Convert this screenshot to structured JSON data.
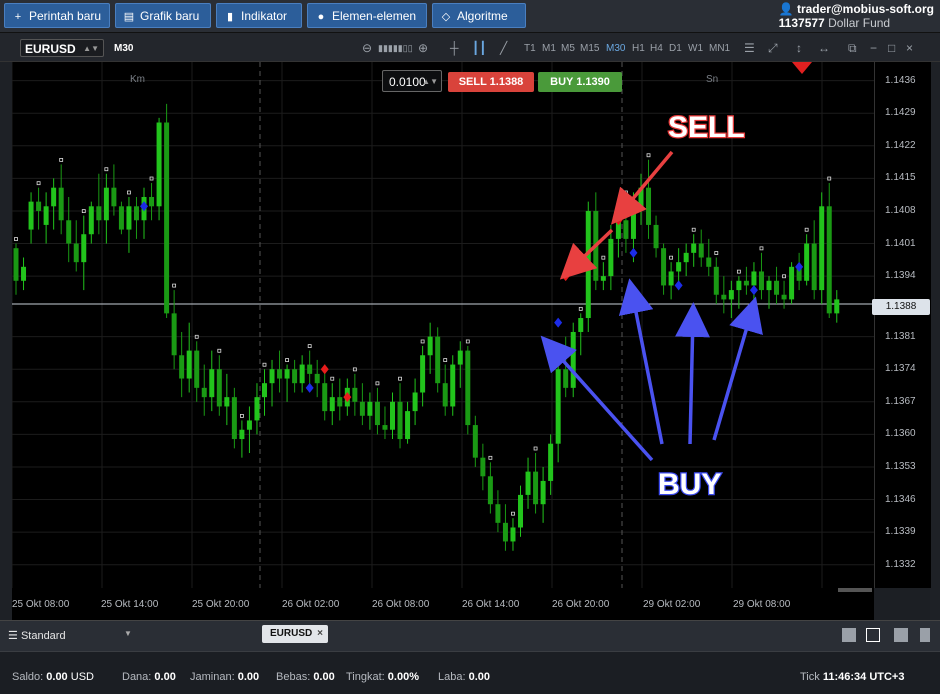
{
  "toolbar": {
    "new_order": "Perintah baru",
    "new_chart": "Grafik baru",
    "indicator": "Indikator",
    "elements": "Elemen-elemen",
    "algorithm": "Algoritme"
  },
  "account": {
    "email": "trader@mobius-soft.org",
    "id": "1137577",
    "fund": "Dollar Fund"
  },
  "chart_header": {
    "symbol": "EURUSD",
    "timeframe": "M30",
    "timeframes": [
      "T1",
      "M1",
      "M5",
      "M15",
      "M30",
      "H1",
      "H4",
      "D1",
      "W1",
      "MN1"
    ],
    "active_timeframe": "M30"
  },
  "trade_panel": {
    "lot": "0.0100",
    "sell_label": "SELL 1.1388",
    "buy_label": "BUY 1.1390"
  },
  "sessions": {
    "left": "Km",
    "right": "Sn"
  },
  "price_axis": {
    "labels": [
      "1.1436",
      "1.1429",
      "1.1422",
      "1.1415",
      "1.1408",
      "1.1401",
      "1.1394",
      "1.1381",
      "1.1374",
      "1.1367",
      "1.1360",
      "1.1353",
      "1.1346",
      "1.1339",
      "1.1332"
    ],
    "current": "1.1388"
  },
  "time_axis": {
    "labels": [
      "25 Okt 08:00",
      "25 Okt 14:00",
      "25 Okt 20:00",
      "26 Okt 02:00",
      "26 Okt 08:00",
      "26 Okt 14:00",
      "26 Okt 20:00",
      "29 Okt 02:00",
      "29 Okt 08:00"
    ]
  },
  "annotations": {
    "sell": "SELL",
    "buy": "BUY"
  },
  "colors": {
    "bull": "#22c41c",
    "bear": "#1a9a14",
    "sell_marker": "#e81c1c",
    "buy_marker": "#1c2ce8",
    "sell_arrow": "#e84040",
    "buy_arrow": "#4a52f0"
  },
  "bottom": {
    "layout": "Standard",
    "symbol_tab": "EURUSD"
  },
  "status": {
    "saldo_label": "Saldo:",
    "saldo_value": "0.00",
    "saldo_currency": "USD",
    "dana_label": "Dana:",
    "dana_value": "0.00",
    "jaminan_label": "Jaminan:",
    "jaminan_value": "0.00",
    "bebas_label": "Bebas:",
    "bebas_value": "0.00",
    "tingkat_label": "Tingkat:",
    "tingkat_value": "0.00%",
    "laba_label": "Laba:",
    "laba_value": "0.00",
    "tick_label": "Tick",
    "time": "11:46:34",
    "tz": "UTC+3"
  },
  "chart_data": {
    "type": "candlestick",
    "symbol": "EURUSD",
    "timeframe": "M30",
    "ylim": [
      1.1327,
      1.144
    ],
    "candles": [
      [
        1.14,
        1.1401,
        1.139,
        1.1393
      ],
      [
        1.1393,
        1.1398,
        1.1391,
        1.1396
      ],
      [
        1.1404,
        1.1412,
        1.1401,
        1.141
      ],
      [
        1.141,
        1.1413,
        1.1404,
        1.1408
      ],
      [
        1.1405,
        1.1412,
        1.1401,
        1.1409
      ],
      [
        1.1409,
        1.1415,
        1.1404,
        1.1413
      ],
      [
        1.1413,
        1.1418,
        1.1403,
        1.1406
      ],
      [
        1.1406,
        1.1411,
        1.1397,
        1.1401
      ],
      [
        1.1401,
        1.1406,
        1.1395,
        1.1397
      ],
      [
        1.1397,
        1.1407,
        1.1391,
        1.1403
      ],
      [
        1.1403,
        1.141,
        1.1401,
        1.1409
      ],
      [
        1.1409,
        1.1416,
        1.1403,
        1.1406
      ],
      [
        1.1406,
        1.1416,
        1.1401,
        1.1413
      ],
      [
        1.1413,
        1.1418,
        1.1407,
        1.1409
      ],
      [
        1.1409,
        1.141,
        1.1403,
        1.1404
      ],
      [
        1.1404,
        1.1411,
        1.1399,
        1.1409
      ],
      [
        1.1409,
        1.1411,
        1.1402,
        1.1406
      ],
      [
        1.1406,
        1.1413,
        1.1402,
        1.1411
      ],
      [
        1.1411,
        1.1414,
        1.1406,
        1.1409
      ],
      [
        1.1409,
        1.1428,
        1.1406,
        1.1427
      ],
      [
        1.1427,
        1.1431,
        1.1385,
        1.1386
      ],
      [
        1.1386,
        1.1391,
        1.1374,
        1.1377
      ],
      [
        1.1377,
        1.1382,
        1.1368,
        1.1372
      ],
      [
        1.1372,
        1.1384,
        1.1369,
        1.1378
      ],
      [
        1.1378,
        1.138,
        1.1367,
        1.137
      ],
      [
        1.137,
        1.1375,
        1.1364,
        1.1368
      ],
      [
        1.1368,
        1.1378,
        1.1365,
        1.1374
      ],
      [
        1.1374,
        1.1377,
        1.1364,
        1.1366
      ],
      [
        1.1366,
        1.1373,
        1.1362,
        1.1368
      ],
      [
        1.1368,
        1.137,
        1.1357,
        1.1359
      ],
      [
        1.1359,
        1.1363,
        1.1355,
        1.1361
      ],
      [
        1.1361,
        1.1366,
        1.1356,
        1.1363
      ],
      [
        1.1363,
        1.1371,
        1.136,
        1.1368
      ],
      [
        1.1368,
        1.1374,
        1.1364,
        1.1371
      ],
      [
        1.1371,
        1.1376,
        1.1366,
        1.1374
      ],
      [
        1.1374,
        1.1378,
        1.1369,
        1.1372
      ],
      [
        1.1372,
        1.1375,
        1.1367,
        1.1374
      ],
      [
        1.1374,
        1.1376,
        1.1369,
        1.1371
      ],
      [
        1.1371,
        1.1377,
        1.1369,
        1.1375
      ],
      [
        1.1375,
        1.1378,
        1.137,
        1.1373
      ],
      [
        1.1373,
        1.1376,
        1.1368,
        1.1371
      ],
      [
        1.1371,
        1.1375,
        1.1363,
        1.1365
      ],
      [
        1.1365,
        1.1371,
        1.1362,
        1.1368
      ],
      [
        1.1368,
        1.1372,
        1.1363,
        1.1366
      ],
      [
        1.1366,
        1.1372,
        1.1364,
        1.137
      ],
      [
        1.137,
        1.1373,
        1.1364,
        1.1367
      ],
      [
        1.1367,
        1.1371,
        1.1362,
        1.1364
      ],
      [
        1.1364,
        1.1369,
        1.1361,
        1.1367
      ],
      [
        1.1367,
        1.137,
        1.136,
        1.1362
      ],
      [
        1.1362,
        1.1366,
        1.1359,
        1.1361
      ],
      [
        1.1361,
        1.1369,
        1.1359,
        1.1367
      ],
      [
        1.1367,
        1.1371,
        1.1357,
        1.1359
      ],
      [
        1.1359,
        1.1367,
        1.1358,
        1.1365
      ],
      [
        1.1365,
        1.1372,
        1.1362,
        1.1369
      ],
      [
        1.1369,
        1.1379,
        1.1366,
        1.1377
      ],
      [
        1.1377,
        1.1384,
        1.1373,
        1.1381
      ],
      [
        1.1381,
        1.1383,
        1.1369,
        1.1371
      ],
      [
        1.1371,
        1.1375,
        1.1364,
        1.1366
      ],
      [
        1.1366,
        1.1377,
        1.1364,
        1.1375
      ],
      [
        1.1375,
        1.138,
        1.137,
        1.1378
      ],
      [
        1.1378,
        1.1379,
        1.136,
        1.1362
      ],
      [
        1.1362,
        1.1364,
        1.1353,
        1.1355
      ],
      [
        1.1355,
        1.1358,
        1.1348,
        1.1351
      ],
      [
        1.1351,
        1.1354,
        1.1343,
        1.1345
      ],
      [
        1.1345,
        1.1348,
        1.1339,
        1.1341
      ],
      [
        1.1341,
        1.1345,
        1.1335,
        1.1337
      ],
      [
        1.1337,
        1.1342,
        1.1335,
        1.134
      ],
      [
        1.134,
        1.1349,
        1.1338,
        1.1347
      ],
      [
        1.1347,
        1.1355,
        1.1344,
        1.1352
      ],
      [
        1.1352,
        1.1356,
        1.1343,
        1.1345
      ],
      [
        1.1345,
        1.1353,
        1.1341,
        1.135
      ],
      [
        1.135,
        1.136,
        1.1347,
        1.1358
      ],
      [
        1.1358,
        1.1376,
        1.1354,
        1.1374
      ],
      [
        1.1374,
        1.1381,
        1.1368,
        1.137
      ],
      [
        1.137,
        1.1384,
        1.1368,
        1.1382
      ],
      [
        1.1382,
        1.1386,
        1.1377,
        1.1385
      ],
      [
        1.1385,
        1.141,
        1.1382,
        1.1408
      ],
      [
        1.1408,
        1.1412,
        1.1391,
        1.1393
      ],
      [
        1.1393,
        1.1397,
        1.1391,
        1.1394
      ],
      [
        1.1394,
        1.1405,
        1.1391,
        1.1402
      ],
      [
        1.1402,
        1.1409,
        1.1398,
        1.1406
      ],
      [
        1.1406,
        1.1411,
        1.1399,
        1.1402
      ],
      [
        1.1402,
        1.1412,
        1.1397,
        1.1409
      ],
      [
        1.1409,
        1.1416,
        1.1405,
        1.1413
      ],
      [
        1.1413,
        1.1419,
        1.1402,
        1.1405
      ],
      [
        1.1405,
        1.1407,
        1.1398,
        1.14
      ],
      [
        1.14,
        1.1401,
        1.139,
        1.1392
      ],
      [
        1.1392,
        1.1397,
        1.1389,
        1.1395
      ],
      [
        1.1395,
        1.14,
        1.1391,
        1.1397
      ],
      [
        1.1397,
        1.1401,
        1.1394,
        1.1399
      ],
      [
        1.1399,
        1.1403,
        1.1396,
        1.1401
      ],
      [
        1.1401,
        1.1404,
        1.1396,
        1.1398
      ],
      [
        1.1398,
        1.1402,
        1.1394,
        1.1396
      ],
      [
        1.1396,
        1.1398,
        1.1388,
        1.139
      ],
      [
        1.139,
        1.1394,
        1.1386,
        1.1389
      ],
      [
        1.1389,
        1.1393,
        1.1385,
        1.1391
      ],
      [
        1.1391,
        1.1394,
        1.1387,
        1.1393
      ],
      [
        1.1393,
        1.1396,
        1.139,
        1.1392
      ],
      [
        1.1392,
        1.1397,
        1.1389,
        1.1395
      ],
      [
        1.1395,
        1.1399,
        1.1389,
        1.1391
      ],
      [
        1.1391,
        1.1394,
        1.1387,
        1.1393
      ],
      [
        1.1393,
        1.1396,
        1.1388,
        1.139
      ],
      [
        1.139,
        1.1393,
        1.1387,
        1.1389
      ],
      [
        1.1389,
        1.1397,
        1.1388,
        1.1396
      ],
      [
        1.1396,
        1.1399,
        1.1391,
        1.1393
      ],
      [
        1.1393,
        1.1403,
        1.1392,
        1.1401
      ],
      [
        1.1401,
        1.1406,
        1.1389,
        1.1391
      ],
      [
        1.1391,
        1.1412,
        1.1388,
        1.1409
      ],
      [
        1.1409,
        1.1414,
        1.1385,
        1.1386
      ],
      [
        1.1386,
        1.1391,
        1.1384,
        1.1389
      ]
    ],
    "sell_signals": [
      [
        73,
        1.1394
      ],
      [
        80,
        1.1406
      ],
      [
        41,
        1.1374
      ],
      [
        44,
        1.1368
      ]
    ],
    "buy_signals": [
      [
        72,
        1.1384
      ],
      [
        82,
        1.1399
      ],
      [
        88,
        1.1392
      ],
      [
        98,
        1.1391
      ],
      [
        104,
        1.1396
      ],
      [
        17,
        1.1409
      ],
      [
        39,
        1.137
      ]
    ],
    "current_price": 1.1388
  }
}
